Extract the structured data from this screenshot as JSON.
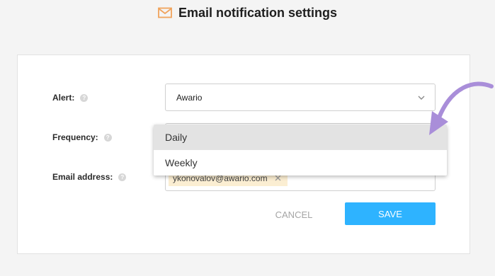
{
  "header": {
    "title": "Email notification settings",
    "icon": "mail-icon"
  },
  "form": {
    "alert": {
      "label": "Alert:",
      "value": "Awario"
    },
    "frequency": {
      "label": "Frequency:",
      "options": [
        "Daily",
        "Weekly"
      ],
      "highlighted": "Daily"
    },
    "email": {
      "label": "Email address:",
      "chip_value": "ykonovalov@awario.com"
    },
    "help_glyph": "?"
  },
  "actions": {
    "cancel_label": "CANCEL",
    "save_label": "SAVE"
  },
  "colors": {
    "accent": "#2eb3ff",
    "mail_icon": "#f0a35c",
    "annotation_arrow": "#a98ed9",
    "chip_bg": "#fbeed2"
  }
}
